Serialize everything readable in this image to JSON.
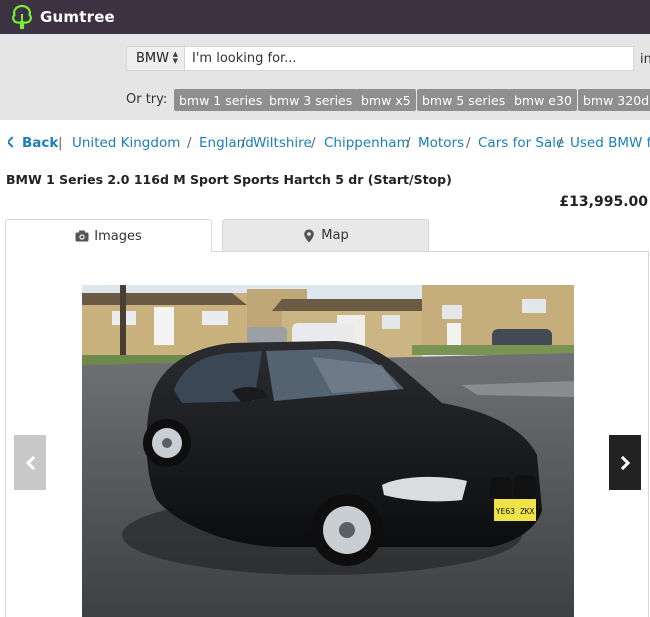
{
  "header": {
    "brand": "Gumtree",
    "brand_color": "#3c3241",
    "logo_icon": "tree-logo-icon",
    "logo_color": "#72ef36"
  },
  "search": {
    "category": "BMW",
    "placeholder": "I'm looking for...",
    "in_label": "in",
    "or_try_label": "Or try:",
    "suggestions": [
      "bmw 1 series",
      "bmw 3 series",
      "bmw x5",
      "bmw 5 series",
      "bmw e30",
      "bmw 320d"
    ]
  },
  "breadcrumb": {
    "back_label": "Back",
    "separator": "/",
    "items": [
      "United Kingdom",
      "England",
      "Wiltshire",
      "Chippenham",
      "Motors",
      "Cars for Sale",
      "Used BMW for"
    ],
    "link_color": "#1a7fb8"
  },
  "listing": {
    "title": "BMW 1 Series 2.0 116d M Sport Sports Hartch 5 dr (Start/Stop)",
    "price": "£13,995.00"
  },
  "tabs": [
    {
      "label": "Images",
      "icon": "camera-icon",
      "active": true
    },
    {
      "label": "Map",
      "icon": "map-pin-icon",
      "active": false
    }
  ],
  "gallery": {
    "prev_icon": "chevron-left-icon",
    "next_icon": "chevron-right-icon",
    "plate_text": "YE63 ZKX"
  }
}
